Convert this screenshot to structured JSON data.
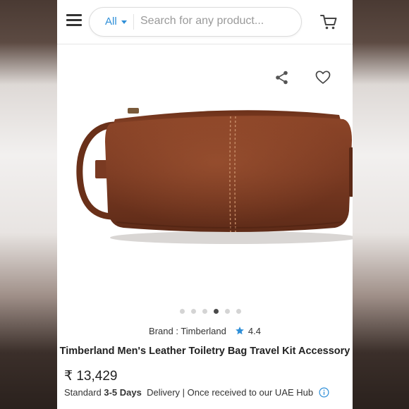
{
  "header": {
    "search": {
      "category": "All",
      "placeholder": "Search for any product..."
    }
  },
  "icons": {
    "menu": "hamburger-menu-icon",
    "cart": "cart-icon",
    "share": "share-icon",
    "wishlist": "heart-icon",
    "rating": "star-icon",
    "info": "info-icon"
  },
  "colors": {
    "accent": "#2f8fd8",
    "leather": "#7a3a22"
  },
  "gallery": {
    "image_count": 6,
    "active_index": 3
  },
  "product": {
    "brand_label": "Brand : Timberland",
    "rating": "4.4",
    "title": "Timberland Men's Leather Toiletry Bag Travel Kit Accessory",
    "price": "₹ 13,429"
  },
  "delivery": {
    "prefix": "Standard ",
    "days": "3-5 Days",
    "suffix": "  Delivery | Once received to our UAE Hub"
  }
}
